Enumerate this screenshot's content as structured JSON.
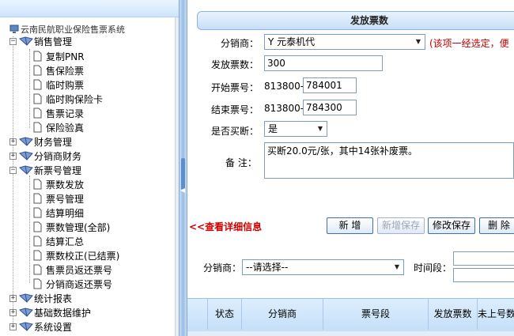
{
  "tree": {
    "root_label": "云南民航职业保险售票系统",
    "items": [
      {
        "label": "销售管理",
        "expanded": true,
        "children": [
          "复制PNR",
          "售保险票",
          "临时购票",
          "临时购保险卡",
          "售票记录",
          "保险验真"
        ]
      },
      {
        "label": "财务管理",
        "expanded": false
      },
      {
        "label": "分销商财务",
        "expanded": false
      },
      {
        "label": "新票号管理",
        "expanded": true,
        "children": [
          "票数发放",
          "票号管理",
          "结算明细",
          "票数管理(全部)",
          "结算汇总",
          "票数校正(已结票)",
          "售票员返还票号",
          "分销商返还票号"
        ]
      },
      {
        "label": "统计报表",
        "expanded": false
      },
      {
        "label": "基础数据维护",
        "expanded": false
      },
      {
        "label": "系统设置",
        "expanded": false
      }
    ]
  },
  "form": {
    "title": "发放票数",
    "distributor_label": "分销商：",
    "distributor_value": "Y 元泰机代",
    "distributor_hint": "(该项一经选定，便",
    "count_label": "发放票数：",
    "count_value": "300",
    "start_label": "开始票号：",
    "start_prefix": "813800-",
    "start_value": "784001",
    "end_label": "结束票号：",
    "end_prefix": "813800-",
    "end_value": "784300",
    "buyout_label": "是否买断：",
    "buyout_value": "是",
    "remark_label": "备  注：",
    "remark_value": "买断20.0元/张，其中14张补废票。"
  },
  "detail_link": "<<查看详细信息",
  "buttons": {
    "add": "新 增",
    "add_save": "新增保存",
    "edit_save": "修改保存",
    "delete": "删 除"
  },
  "filter": {
    "distributor_label": "分销商：",
    "distributor_placeholder": "--请选择--",
    "time_label": "时间段："
  },
  "table_headers": [
    "状态",
    "分销商",
    "票号段",
    "发放票数",
    "未上号数"
  ],
  "colors": {
    "accent_blue": "#8fb4de",
    "hint_red": "#c00000",
    "link_red": "#d00000"
  }
}
